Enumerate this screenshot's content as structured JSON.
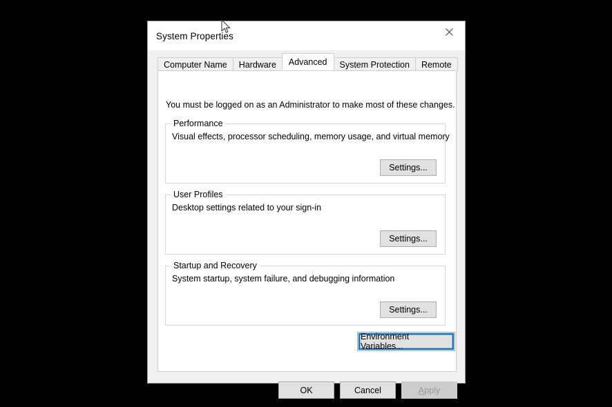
{
  "window": {
    "title": "System Properties",
    "close_icon": "close-icon"
  },
  "tabs": [
    {
      "label": "Computer Name",
      "selected": false
    },
    {
      "label": "Hardware",
      "selected": false
    },
    {
      "label": "Advanced",
      "selected": true
    },
    {
      "label": "System Protection",
      "selected": false
    },
    {
      "label": "Remote",
      "selected": false
    }
  ],
  "content": {
    "admin_note": "You must be logged on as an Administrator to make most of these changes.",
    "groups": [
      {
        "legend": "Performance",
        "description": "Visual effects, processor scheduling, memory usage, and virtual memory",
        "button": "Settings..."
      },
      {
        "legend": "User Profiles",
        "description": "Desktop settings related to your sign-in",
        "button": "Settings..."
      },
      {
        "legend": "Startup and Recovery",
        "description": "System startup, system failure, and debugging information",
        "button": "Settings..."
      }
    ],
    "environment_variables_button": "Environment Variables..."
  },
  "footer": {
    "ok": "OK",
    "cancel": "Cancel",
    "apply_accel": "A",
    "apply_rest": "pply"
  },
  "colors": {
    "focus_outline": "#0078d7",
    "dialog_background": "#f0f0f0",
    "panel_background": "#ffffff",
    "button_face": "#e1e1e1",
    "disabled_text": "#9a9a9a"
  }
}
